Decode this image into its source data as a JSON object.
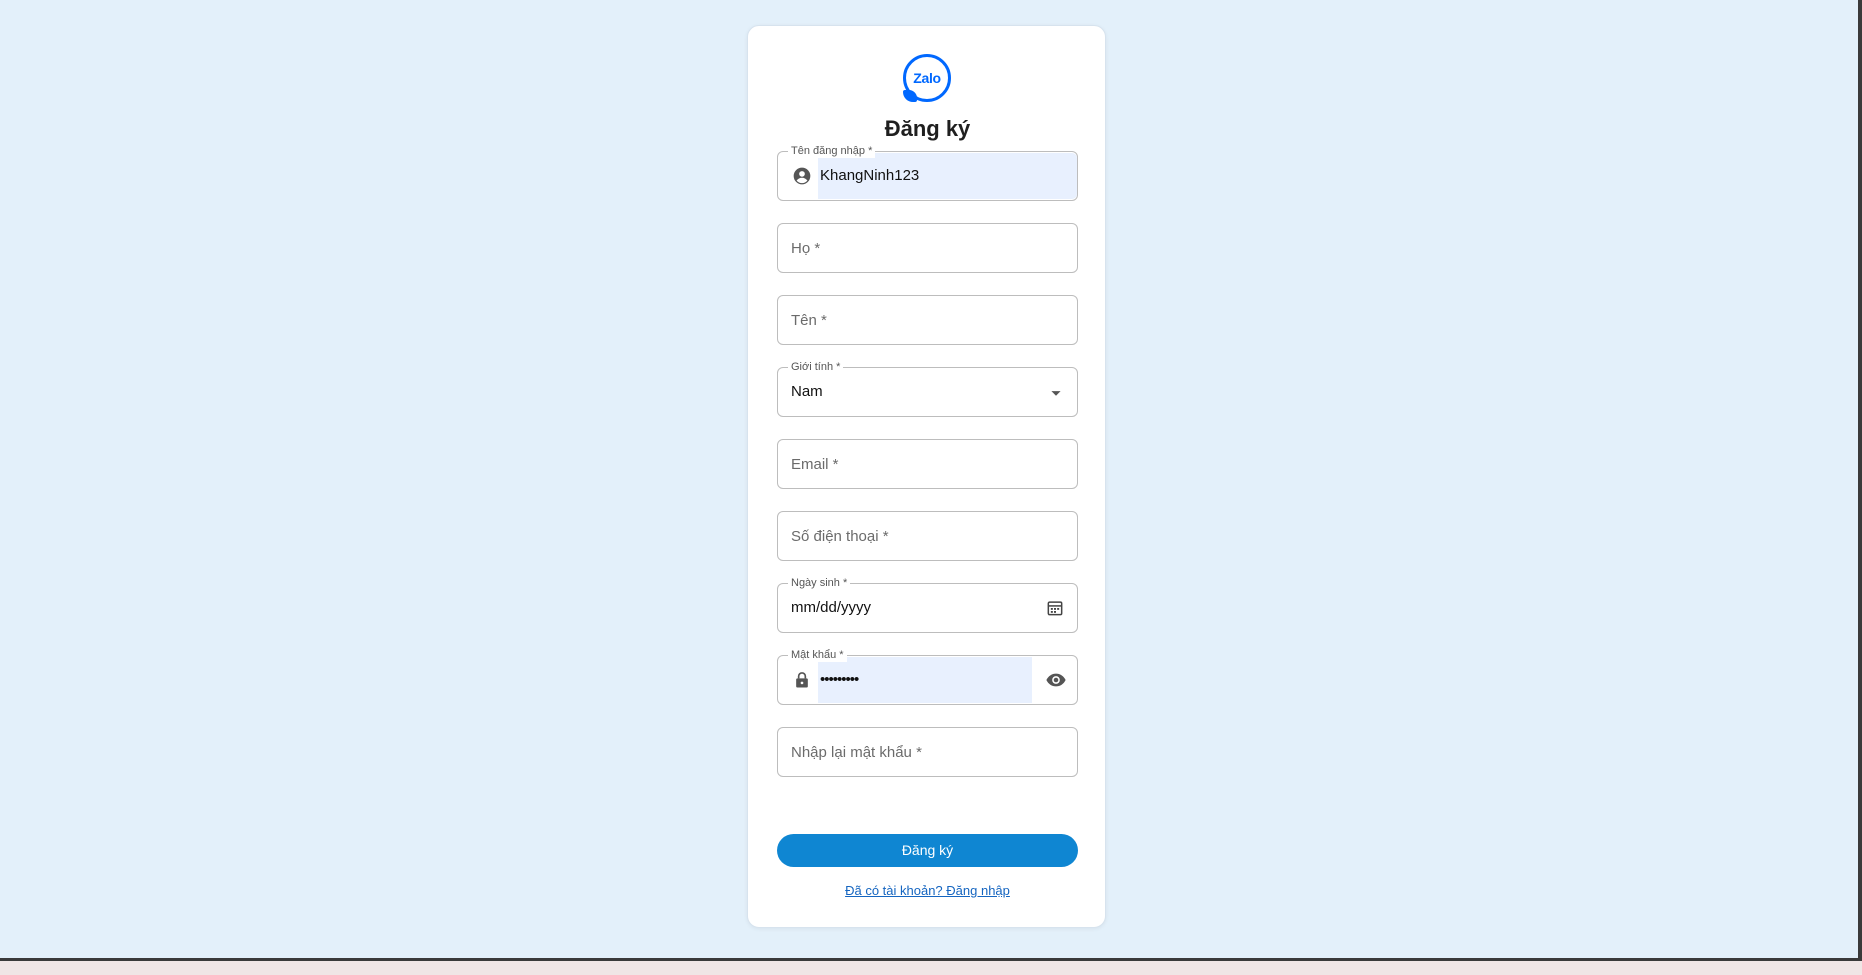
{
  "app": {
    "logo_text": "Zalo",
    "title": "Đăng ký"
  },
  "form": {
    "username": {
      "label": "Tên đăng nhập *",
      "value": "KhangNinh123",
      "icon": "account-circle-icon"
    },
    "last_name": {
      "label": "Họ *"
    },
    "first_name": {
      "label": "Tên *"
    },
    "gender": {
      "label": "Giới tính *",
      "selected": "Nam",
      "icon": "dropdown-arrow-icon"
    },
    "email": {
      "label": "Email *"
    },
    "phone": {
      "label": "Số điện thoại *"
    },
    "birthday": {
      "label": "Ngày sinh *",
      "placeholder": "mm/dd/yyyy",
      "icon": "calendar-icon"
    },
    "password": {
      "label": "Mật khẩu *",
      "value": "•••••••••",
      "icon": "lock-icon",
      "toggle_icon": "eye-icon"
    },
    "confirm_password": {
      "label": "Nhập lại mật khẩu *"
    }
  },
  "actions": {
    "submit_label": "Đăng ký",
    "login_link": "Đã có tài khoản? Đăng nhập"
  },
  "colors": {
    "background": "#e3f0fa",
    "primary_button": "#0f86d2",
    "brand": "#0068ff",
    "autofill_bg": "#e8f0fe"
  }
}
